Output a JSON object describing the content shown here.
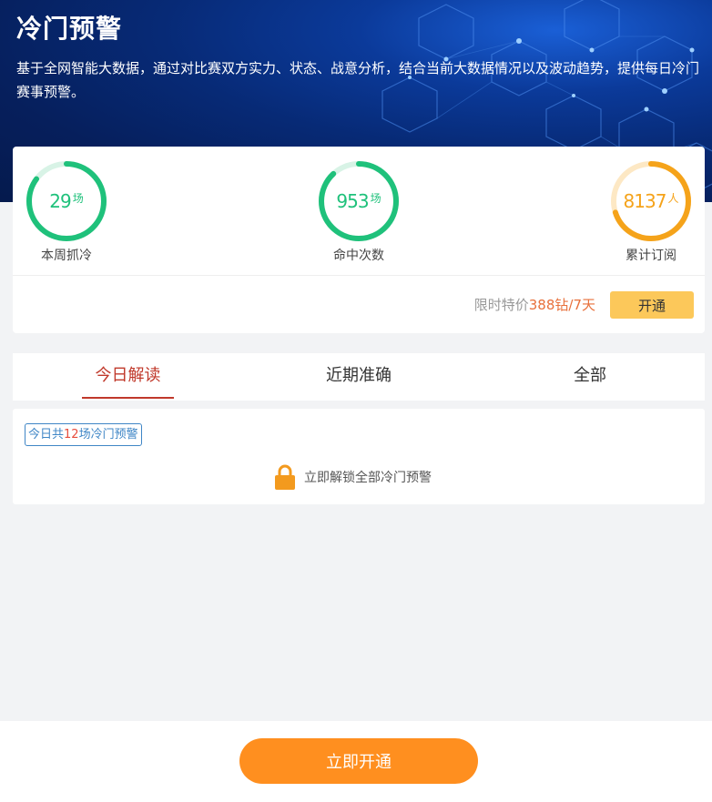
{
  "header": {
    "title": "冷门预警",
    "description": "基于全网智能大数据，通过对比赛双方实力、状态、战意分析，结合当前大数据情况以及波动趋势，提供每日冷门赛事预警。"
  },
  "stats": [
    {
      "value": "29",
      "unit": "场",
      "label": "本周抓冷",
      "progress": 0.85,
      "color": "#1fc17b",
      "track_color": "#d8f3e6"
    },
    {
      "value": "953",
      "unit": "场",
      "label": "命中次数",
      "progress": 0.88,
      "color": "#1fc17b",
      "track_color": "#d8f3e6"
    },
    {
      "value": "8137",
      "unit": "人",
      "label": "累计订阅",
      "progress": 0.7,
      "color": "#f5a31a",
      "track_color": "#fde8c4"
    }
  ],
  "promo": {
    "prefix": "限时特价",
    "price": "388钻/7天",
    "button_label": "开通"
  },
  "tabs": [
    {
      "label": "今日解读",
      "active": true
    },
    {
      "label": "近期准确",
      "active": false
    },
    {
      "label": "全部",
      "active": false
    }
  ],
  "content": {
    "badge_prefix": "今日共",
    "badge_count": "12",
    "badge_suffix": "场冷门预警",
    "lock_icon": "lock-icon",
    "unlock_text": "立即解锁全部冷门预警"
  },
  "footer": {
    "cta_label": "立即开通"
  },
  "colors": {
    "accent_red": "#c0392b",
    "green": "#1fc17b",
    "orange": "#f5a31a",
    "cta_orange": "#ff8f1f",
    "button_yellow": "#fcc85a"
  }
}
